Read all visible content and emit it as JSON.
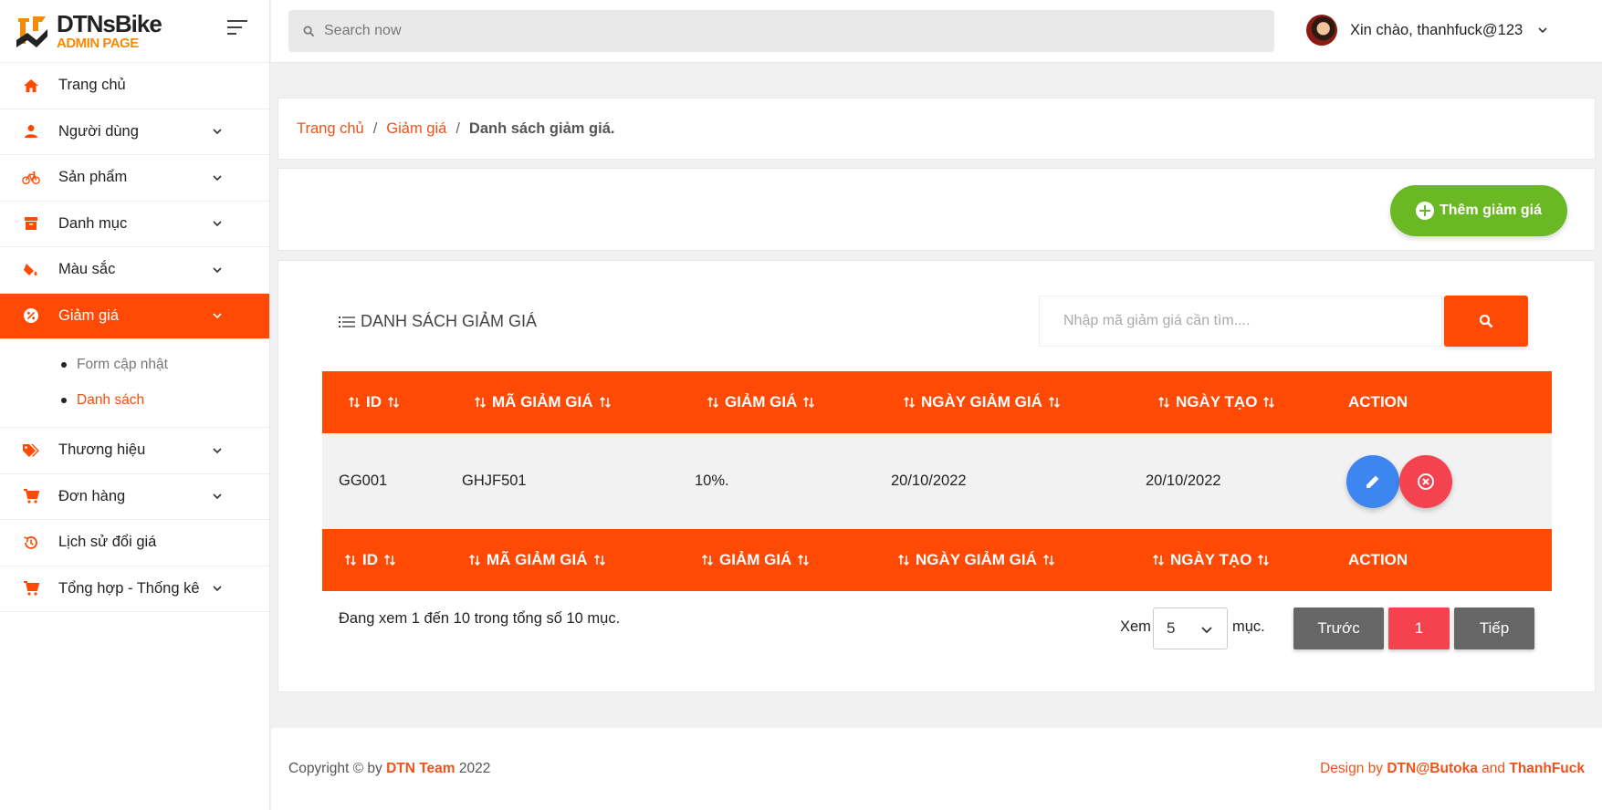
{
  "brand": {
    "name": "DTNsBike",
    "subtitle": "ADMIN PAGE"
  },
  "header": {
    "search_placeholder": "Search now",
    "greeting": "Xin chào, thanhfuck@123"
  },
  "sidebar": {
    "items": [
      {
        "label": "Trang chủ",
        "icon": "home-icon"
      },
      {
        "label": "Người dùng",
        "icon": "user-icon"
      },
      {
        "label": "Sản phẩm",
        "icon": "bike-icon"
      },
      {
        "label": "Danh mục",
        "icon": "archive-icon"
      },
      {
        "label": "Màu sắc",
        "icon": "paint-bucket-icon"
      },
      {
        "label": "Giảm giá",
        "icon": "discount-icon"
      },
      {
        "label": "Thương hiệu",
        "icon": "tags-icon"
      },
      {
        "label": "Đơn hàng",
        "icon": "cart-icon"
      },
      {
        "label": "Lịch sử đổi giá",
        "icon": "history-icon"
      },
      {
        "label": "Tổng hợp - Thống kê",
        "icon": "cart-icon"
      }
    ],
    "submenu": [
      {
        "label": "Form cập nhật"
      },
      {
        "label": "Danh sách"
      }
    ]
  },
  "breadcrumb": {
    "home": "Trang chủ",
    "section": "Giảm giá",
    "current": "Danh sách giảm giá.",
    "separator": "/"
  },
  "toolbar": {
    "add_label": "Thêm giảm giá"
  },
  "list": {
    "title": "DANH SÁCH GIẢM GIÁ",
    "filter_placeholder": "Nhập mã giảm giá cần tìm....",
    "columns": [
      "ID",
      "MÃ GIẢM GIÁ",
      "GIẢM GIÁ",
      "NGÀY GIẢM GIÁ",
      "NGÀY TẠO",
      "ACTION"
    ],
    "rows": [
      {
        "id": "GG001",
        "code": "GHJF501",
        "discount": "10%.",
        "discount_date": "20/10/2022",
        "created": "20/10/2022"
      }
    ],
    "info": "Đang xem 1 đến 10 trong tổng số 10 mục.",
    "show_label": "Xem",
    "page_size": "5",
    "unit_label": "mục.",
    "prev_label": "Trước",
    "page": "1",
    "next_label": "Tiếp"
  },
  "footer": {
    "copyright_prefix": "Copyright © by",
    "team": "DTN Team",
    "year": "2022",
    "design_prefix": "Design by",
    "designer1": "DTN@Butoka",
    "and": "and",
    "designer2": "ThanhFuck"
  },
  "colors": {
    "accent": "#ff4a05",
    "add": "#6bb825",
    "edit": "#3d86f0",
    "delete": "#f5424f",
    "pager": "#666666"
  }
}
